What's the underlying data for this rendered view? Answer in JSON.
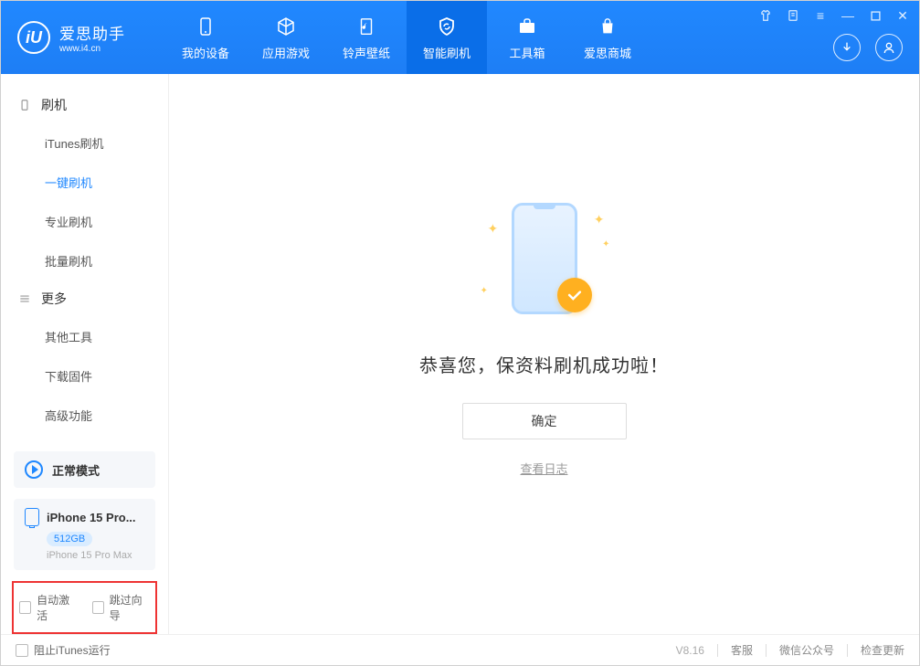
{
  "app": {
    "title": "爱思助手",
    "url": "www.i4.cn"
  },
  "nav": [
    {
      "label": "我的设备"
    },
    {
      "label": "应用游戏"
    },
    {
      "label": "铃声壁纸"
    },
    {
      "label": "智能刷机"
    },
    {
      "label": "工具箱"
    },
    {
      "label": "爱思商城"
    }
  ],
  "sidebar": {
    "group1": "刷机",
    "items1": [
      "iTunes刷机",
      "一键刷机",
      "专业刷机",
      "批量刷机"
    ],
    "group2": "更多",
    "items2": [
      "其他工具",
      "下载固件",
      "高级功能"
    ],
    "mode": "正常模式",
    "device": {
      "name": "iPhone 15 Pro...",
      "storage": "512GB",
      "model": "iPhone 15 Pro Max"
    },
    "chk1": "自动激活",
    "chk2": "跳过向导"
  },
  "main": {
    "success": "恭喜您，保资料刷机成功啦！",
    "ok": "确定",
    "log": "查看日志"
  },
  "footer": {
    "block_itunes": "阻止iTunes运行",
    "version": "V8.16",
    "links": [
      "客服",
      "微信公众号",
      "检查更新"
    ]
  }
}
